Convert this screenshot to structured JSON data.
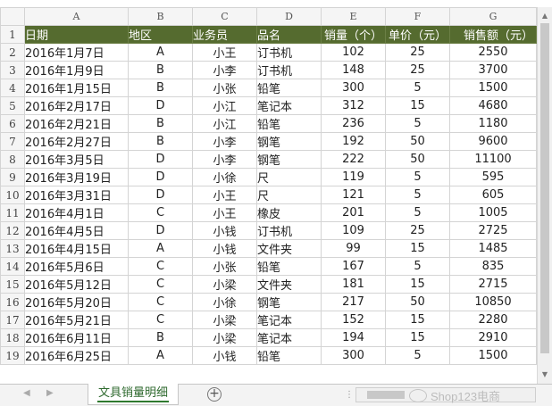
{
  "columns": [
    "A",
    "B",
    "C",
    "D",
    "E",
    "F",
    "G"
  ],
  "header_row_number": "1",
  "headers": [
    "日期",
    "地区",
    "业务员",
    "品名",
    "销量（个）",
    "单价（元）",
    "销售额（元）"
  ],
  "rows": [
    {
      "num": "2",
      "date": "2016年1月7日",
      "region": "A",
      "rep": "小王",
      "product": "订书机",
      "qty": "102",
      "price": "25",
      "sales": "2550"
    },
    {
      "num": "3",
      "date": "2016年1月9日",
      "region": "B",
      "rep": "小李",
      "product": "订书机",
      "qty": "148",
      "price": "25",
      "sales": "3700"
    },
    {
      "num": "4",
      "date": "2016年1月15日",
      "region": "B",
      "rep": "小张",
      "product": "铅笔",
      "qty": "300",
      "price": "5",
      "sales": "1500"
    },
    {
      "num": "5",
      "date": "2016年2月17日",
      "region": "D",
      "rep": "小江",
      "product": "笔记本",
      "qty": "312",
      "price": "15",
      "sales": "4680"
    },
    {
      "num": "6",
      "date": "2016年2月21日",
      "region": "B",
      "rep": "小江",
      "product": "铅笔",
      "qty": "236",
      "price": "5",
      "sales": "1180"
    },
    {
      "num": "7",
      "date": "2016年2月27日",
      "region": "B",
      "rep": "小李",
      "product": "钢笔",
      "qty": "192",
      "price": "50",
      "sales": "9600"
    },
    {
      "num": "8",
      "date": "2016年3月5日",
      "region": "D",
      "rep": "小李",
      "product": "钢笔",
      "qty": "222",
      "price": "50",
      "sales": "11100"
    },
    {
      "num": "9",
      "date": "2016年3月19日",
      "region": "D",
      "rep": "小徐",
      "product": "尺",
      "qty": "119",
      "price": "5",
      "sales": "595"
    },
    {
      "num": "10",
      "date": "2016年3月31日",
      "region": "D",
      "rep": "小王",
      "product": "尺",
      "qty": "121",
      "price": "5",
      "sales": "605"
    },
    {
      "num": "11",
      "date": "2016年4月1日",
      "region": "C",
      "rep": "小王",
      "product": "橡皮",
      "qty": "201",
      "price": "5",
      "sales": "1005"
    },
    {
      "num": "12",
      "date": "2016年4月5日",
      "region": "D",
      "rep": "小钱",
      "product": "订书机",
      "qty": "109",
      "price": "25",
      "sales": "2725"
    },
    {
      "num": "13",
      "date": "2016年4月15日",
      "region": "A",
      "rep": "小钱",
      "product": "文件夹",
      "qty": "99",
      "price": "15",
      "sales": "1485"
    },
    {
      "num": "14",
      "date": "2016年5月6日",
      "region": "C",
      "rep": "小张",
      "product": "铅笔",
      "qty": "167",
      "price": "5",
      "sales": "835"
    },
    {
      "num": "15",
      "date": "2016年5月12日",
      "region": "C",
      "rep": "小梁",
      "product": "文件夹",
      "qty": "181",
      "price": "15",
      "sales": "2715"
    },
    {
      "num": "16",
      "date": "2016年5月20日",
      "region": "C",
      "rep": "小徐",
      "product": "钢笔",
      "qty": "217",
      "price": "50",
      "sales": "10850"
    },
    {
      "num": "17",
      "date": "2016年5月21日",
      "region": "C",
      "rep": "小梁",
      "product": "笔记本",
      "qty": "152",
      "price": "15",
      "sales": "2280"
    },
    {
      "num": "18",
      "date": "2016年6月11日",
      "region": "B",
      "rep": "小梁",
      "product": "笔记本",
      "qty": "194",
      "price": "15",
      "sales": "2910"
    },
    {
      "num": "19",
      "date": "2016年6月25日",
      "region": "A",
      "rep": "小钱",
      "product": "铅笔",
      "qty": "300",
      "price": "5",
      "sales": "1500"
    }
  ],
  "sheet_tab": "文具销量明细",
  "watermark": "Shop123电商",
  "icons": {
    "scroll_up": "scroll-up-arrow-icon",
    "scroll_down": "scroll-down-arrow-icon",
    "tab_prev": "tab-prev-arrow-icon",
    "tab_next": "tab-next-arrow-icon",
    "add_sheet": "add-sheet-plus-icon",
    "watermark_logo": "wechat-logo-icon"
  },
  "colors": {
    "header_fill": "#556b2f",
    "header_text": "#ffffff",
    "tab_text": "#2f6a2f"
  }
}
